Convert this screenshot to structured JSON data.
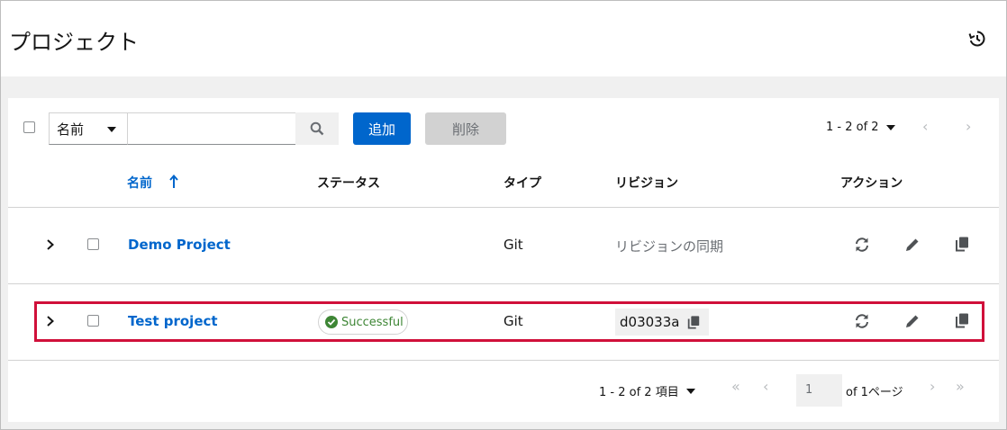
{
  "page": {
    "title": "プロジェクト"
  },
  "toolbar": {
    "filter_selected": "名前",
    "search_placeholder": "",
    "add_label": "追加",
    "delete_label": "削除",
    "pager": "1 - 2 of 2"
  },
  "table": {
    "headers": {
      "name": "名前",
      "status": "ステータス",
      "type": "タイプ",
      "revision": "リビジョン",
      "actions": "アクション"
    },
    "rows": [
      {
        "name": "Demo Project",
        "status": "",
        "type": "Git",
        "revision": "リビジョンの同期"
      },
      {
        "name": "Test project",
        "status": "Successful",
        "type": "Git",
        "revision": "d03033a"
      }
    ]
  },
  "footer": {
    "range": "1 - 2 of 2 項目",
    "page": "1",
    "of_pages": "of 1ページ"
  },
  "colors": {
    "accent": "#0066cc",
    "success": "#3e8635",
    "highlight": "#d0103a"
  }
}
